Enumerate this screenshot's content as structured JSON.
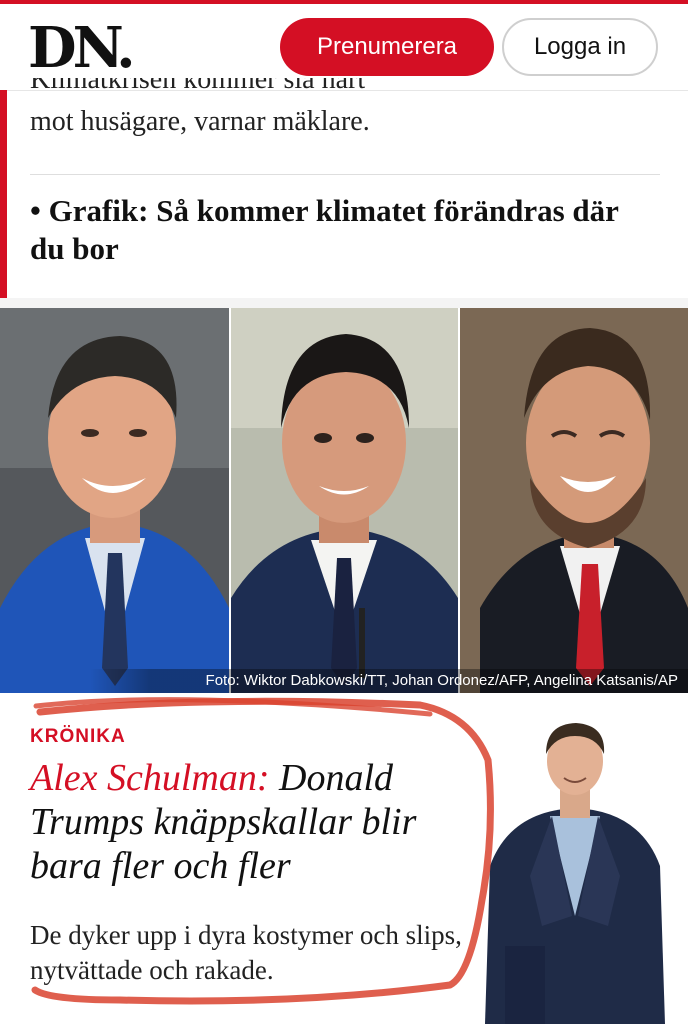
{
  "header": {
    "logo": "DN.",
    "subscribe_label": "Prenumerera",
    "login_label": "Logga in"
  },
  "related": {
    "partial_line": "Klimatkrisen kommer slå hårt",
    "line_1": "mot husägare, varnar mäklare.",
    "line_2": "• Grafik: Så kommer klimatet förändras där du bor"
  },
  "photo": {
    "credit": "Foto: Wiktor Dabkowski/TT, Johan Ordonez/AFP, Angelina Katsanis/AP"
  },
  "article": {
    "kicker": "KRÖNIKA",
    "author": "Alex Schulman:",
    "title": "Donald Trumps knäppskallar blir bara fler och fler",
    "lead": "De dyker upp i dyra kostymer och slips, nytvättade och rakade."
  },
  "colors": {
    "brand_red": "#d40f24",
    "annotation_red": "#d9432f"
  }
}
